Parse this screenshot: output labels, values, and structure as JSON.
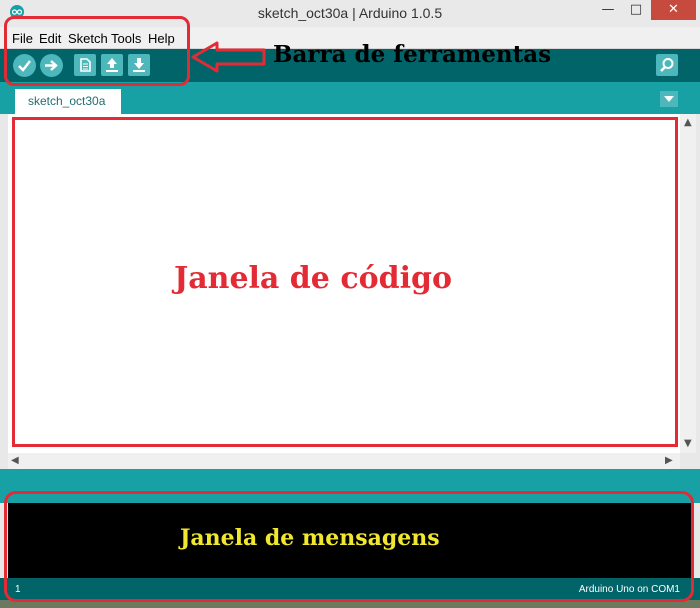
{
  "window": {
    "title": "sketch_oct30a | Arduino 1.0.5",
    "minimize_glyph": "—",
    "maximize_glyph": "□",
    "close_glyph": "✕"
  },
  "menu": {
    "items": [
      "File",
      "Edit",
      "Sketch",
      "Tools",
      "Help"
    ]
  },
  "toolbar": {
    "buttons": [
      "verify-icon",
      "upload-icon",
      "new-icon",
      "open-icon",
      "save-icon"
    ],
    "serial_monitor_icon": "magnifier-icon"
  },
  "tabs": {
    "items": [
      {
        "label": "sketch_oct30a"
      }
    ],
    "dropdown_icon": "triangle-down-icon"
  },
  "editor": {
    "content": ""
  },
  "footer": {
    "line_number": "1",
    "board": "Arduino Uno on COM1"
  },
  "annotations": {
    "toolbar_label": "Barra de ferramentas",
    "editor_label": "Janela de código",
    "console_label": "Janela de mensagens",
    "color": "#e32b36",
    "console_label_color": "#f1e72e"
  },
  "colors": {
    "toolbar_bg": "#006468",
    "tabs_bg": "#17a1a5",
    "button_bg": "#4db7bb"
  }
}
